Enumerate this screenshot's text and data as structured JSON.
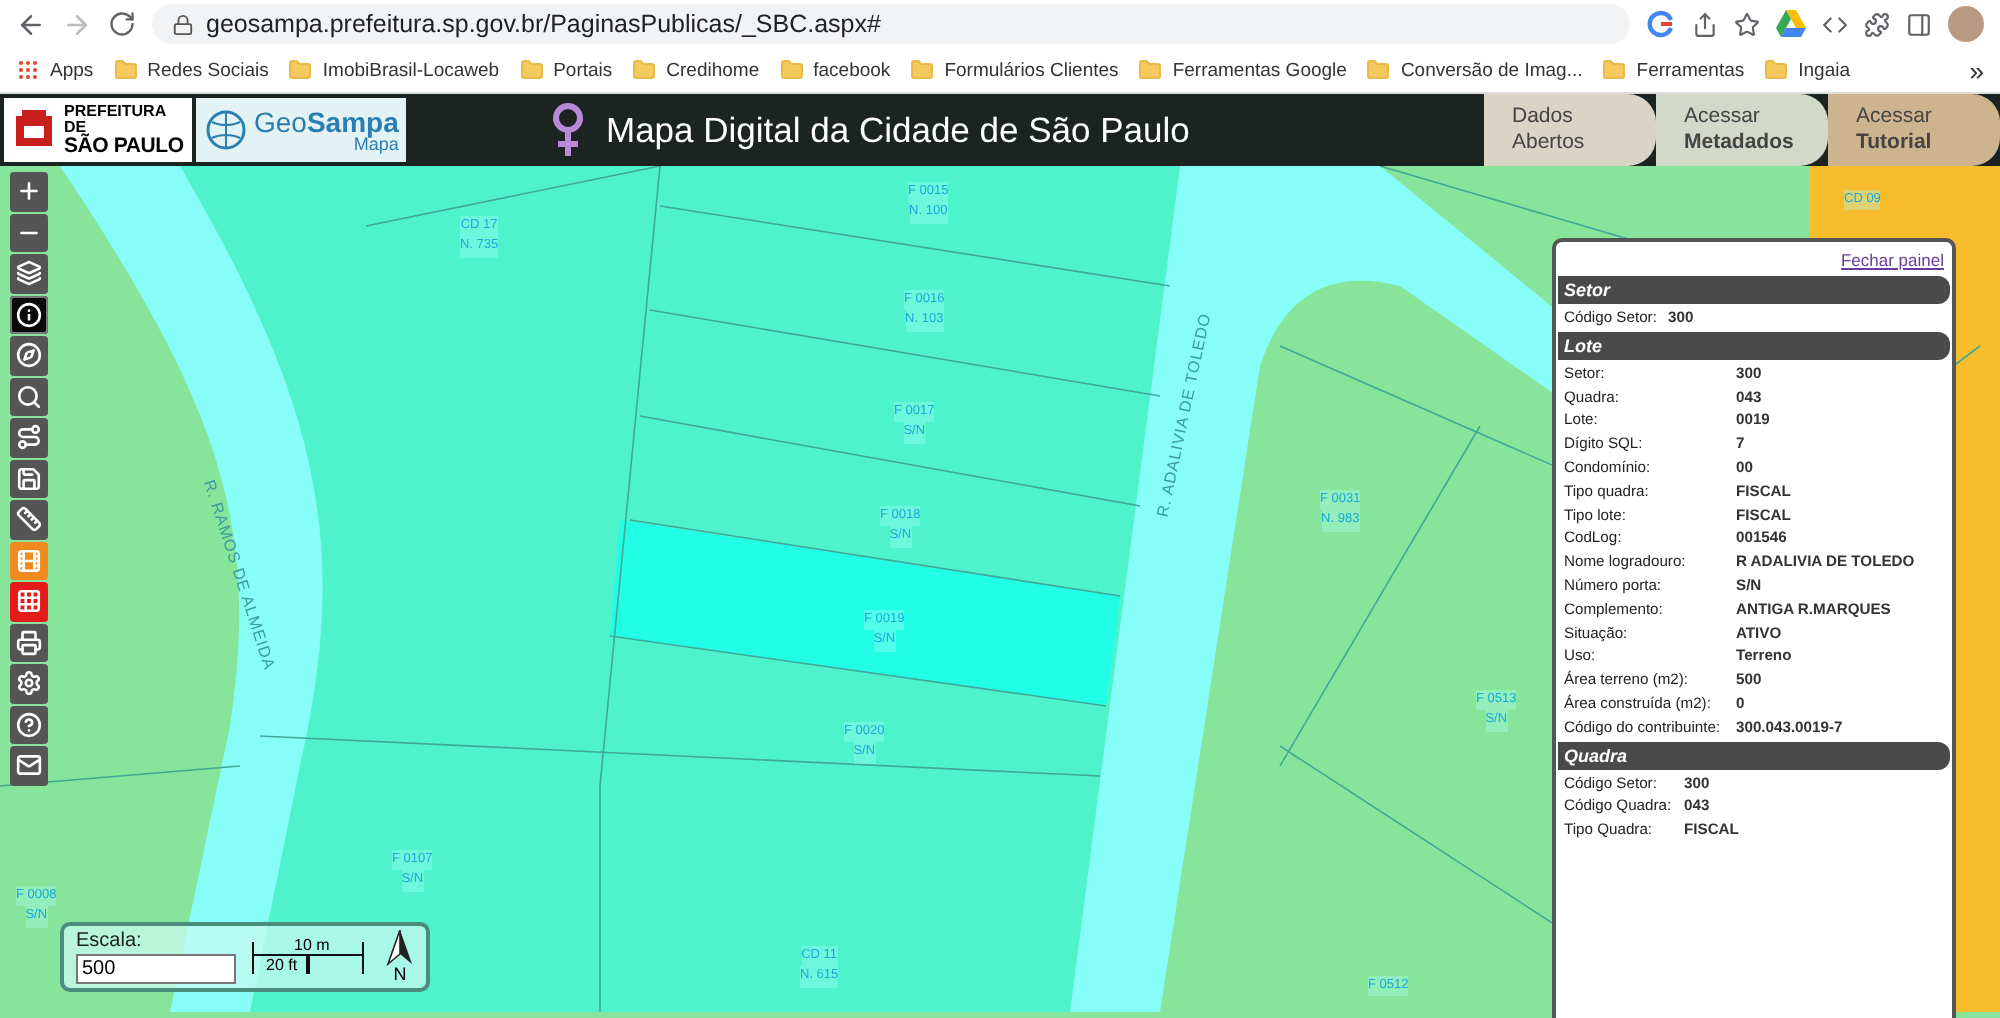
{
  "browser": {
    "url": "geosampa.prefeitura.sp.gov.br/PaginasPublicas/_SBC.aspx#",
    "bookmarks": [
      {
        "label": "Apps",
        "kind": "apps"
      },
      {
        "label": "Redes Sociais",
        "kind": "folder"
      },
      {
        "label": "ImobiBrasil-Locaweb",
        "kind": "folder"
      },
      {
        "label": "Portais",
        "kind": "folder"
      },
      {
        "label": "Credihome",
        "kind": "folder"
      },
      {
        "label": "facebook",
        "kind": "folder"
      },
      {
        "label": "Formulários Clientes",
        "kind": "folder"
      },
      {
        "label": "Ferramentas Google",
        "kind": "folder"
      },
      {
        "label": "Conversão de Imag...",
        "kind": "folder"
      },
      {
        "label": "Ferramentas",
        "kind": "folder"
      },
      {
        "label": "Ingaia",
        "kind": "folder"
      }
    ],
    "more": "»"
  },
  "header": {
    "city_logo": {
      "top": "PREFEITURA DE",
      "bottom": "SÃO PAULO"
    },
    "app_logo": {
      "geo": "Geo",
      "sampa": "Sampa",
      "sub": "Mapa"
    },
    "title": "Mapa Digital da Cidade de São Paulo",
    "nav": [
      {
        "top": "Dados",
        "bottom": "Abertos",
        "bold_bottom": false,
        "color": "#d9d4c6"
      },
      {
        "top": "Acessar",
        "bottom": "Metadados",
        "bold_bottom": true,
        "color": "#d3d9c8"
      },
      {
        "top": "Acessar",
        "bottom": "Tutorial",
        "bold_bottom": true,
        "color": "#cdb48e"
      }
    ]
  },
  "toolbar": [
    {
      "kind": "plus",
      "selected": false,
      "color": "#555555"
    },
    {
      "kind": "minus",
      "selected": false,
      "color": "#555555"
    },
    {
      "kind": "layers",
      "selected": false,
      "color": "#555555"
    },
    {
      "kind": "info",
      "selected": true,
      "color": "#0a0a0a"
    },
    {
      "kind": "compass",
      "selected": false,
      "color": "#555555"
    },
    {
      "kind": "search",
      "selected": false,
      "color": "#555555"
    },
    {
      "kind": "route",
      "selected": false,
      "color": "#555555"
    },
    {
      "kind": "save",
      "selected": false,
      "color": "#555555"
    },
    {
      "kind": "ruler",
      "selected": false,
      "color": "#555555"
    },
    {
      "kind": "film",
      "selected": false,
      "color": "#f08a1e"
    },
    {
      "kind": "grid",
      "selected": false,
      "color": "#e51b1b"
    },
    {
      "kind": "print",
      "selected": false,
      "color": "#555555"
    },
    {
      "kind": "settings",
      "selected": false,
      "color": "#555555"
    },
    {
      "kind": "help",
      "selected": false,
      "color": "#555555"
    },
    {
      "kind": "mail",
      "selected": false,
      "color": "#555555"
    }
  ],
  "map": {
    "labels": [
      {
        "line1": "CD 17",
        "line2": "N. 735"
      },
      {
        "line1": "F 0015",
        "line2": "N. 100"
      },
      {
        "line1": "F 0016",
        "line2": "N. 103"
      },
      {
        "line1": "F 0017",
        "line2": "S/N"
      },
      {
        "line1": "F 0018",
        "line2": "S/N"
      },
      {
        "line1": "F 0019",
        "line2": "S/N"
      },
      {
        "line1": "F 0020",
        "line2": "S/N"
      },
      {
        "line1": "CD 11",
        "line2": "N. 615"
      },
      {
        "line1": "F 0031",
        "line2": "N. 983"
      },
      {
        "line1": "F 0513",
        "line2": "S/N"
      },
      {
        "line1": "F 0107",
        "line2": "S/N"
      },
      {
        "line1": "F 0008",
        "line2": "S/N"
      },
      {
        "line1": "F 0512"
      },
      {
        "line1": "CD 09"
      }
    ],
    "streets": [
      "R. RAMOS DE ALMEIDA",
      "R. ADALIVIA DE TOLEDO"
    ]
  },
  "scale": {
    "label": "Escala:",
    "value": "500",
    "metric": "10 m",
    "imperial": "20 ft",
    "north": "N"
  },
  "panel": {
    "close": "Fechar painel",
    "sections": [
      {
        "title": "Setor",
        "rows": [
          {
            "label": "Código Setor:",
            "value": "300"
          }
        ]
      },
      {
        "title": "Lote",
        "rows": [
          {
            "label": "Setor:",
            "value": "300"
          },
          {
            "label": "Quadra:",
            "value": "043"
          },
          {
            "label": "Lote:",
            "value": "0019"
          },
          {
            "label": "Dígito SQL:",
            "value": "7"
          },
          {
            "label": "Condomínio:",
            "value": "00"
          },
          {
            "label": "Tipo quadra:",
            "value": "FISCAL"
          },
          {
            "label": "Tipo lote:",
            "value": "FISCAL"
          },
          {
            "label": "CodLog:",
            "value": "001546"
          },
          {
            "label": "Nome logradouro:",
            "value": "R ADALIVIA DE TOLEDO"
          },
          {
            "label": "Número porta:",
            "value": "S/N"
          },
          {
            "label": "Complemento:",
            "value": "ANTIGA R.MARQUES"
          },
          {
            "label": "Situação:",
            "value": "ATIVO"
          },
          {
            "label": "Uso:",
            "value": "Terreno"
          },
          {
            "label": "Área terreno (m2):",
            "value": "500"
          },
          {
            "label": "Área construída (m2):",
            "value": "0"
          },
          {
            "label": "Código do contribuinte:",
            "value": "300.043.0019-7"
          }
        ]
      },
      {
        "title": "Quadra",
        "rows": [
          {
            "label": "Código Setor:",
            "value": "300"
          },
          {
            "label": "Código Quadra:",
            "value": "043"
          },
          {
            "label": "Tipo Quadra:",
            "value": "FISCAL"
          }
        ]
      }
    ]
  }
}
